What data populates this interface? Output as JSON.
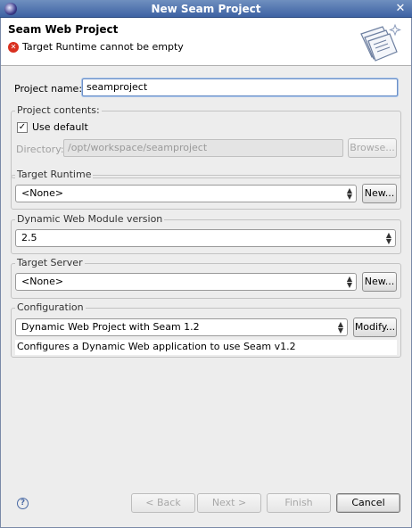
{
  "window": {
    "title": "New Seam Project"
  },
  "banner": {
    "page_title": "Seam Web Project",
    "error_message": "Target Runtime cannot be empty"
  },
  "project_name": {
    "label": "Project name:",
    "value": "seamproject"
  },
  "project_contents": {
    "group_title": "Project contents:",
    "use_default_label": "Use default",
    "use_default_checked": true,
    "directory_label": "Directory:",
    "directory_value": "/opt/workspace/seamproject",
    "browse_label": "Browse..."
  },
  "target_runtime": {
    "group_title": "Target Runtime",
    "selected": "<None>",
    "new_label": "New..."
  },
  "web_module": {
    "group_title": "Dynamic Web Module version",
    "selected": "2.5"
  },
  "target_server": {
    "group_title": "Target Server",
    "selected": "<None>",
    "new_label": "New..."
  },
  "configuration": {
    "group_title": "Configuration",
    "selected": "Dynamic Web Project with Seam 1.2",
    "modify_label": "Modify...",
    "description": "Configures a Dynamic Web application to use Seam v1.2"
  },
  "footer": {
    "back_label": "< Back",
    "next_label": "Next >",
    "finish_label": "Finish",
    "cancel_label": "Cancel"
  },
  "icons": {
    "app": "eclipse-icon",
    "close": "close-icon",
    "error": "error-icon",
    "wizard": "wizard-banner-icon",
    "help": "help-icon",
    "dropdown": "chevron-updown-icon"
  }
}
